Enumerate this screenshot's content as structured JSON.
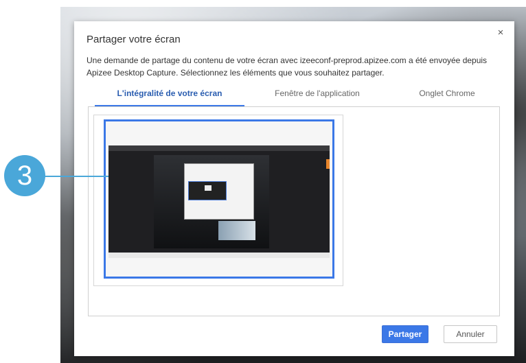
{
  "dialog": {
    "title": "Partager votre écran",
    "close_glyph": "×",
    "description": "Une demande de partage du contenu de votre écran avec izeeconf-preprod.apizee.com a été envoyée depuis Apizee Desktop Capture. Sélectionnez les éléments que vous souhaitez partager.",
    "tabs": [
      {
        "label": "L'intégralité de votre écran",
        "active": true
      },
      {
        "label": "Fenêtre de l'application",
        "active": false
      },
      {
        "label": "Onglet Chrome",
        "active": false
      }
    ],
    "primary_button": "Partager",
    "secondary_button": "Annuler"
  },
  "annotation": {
    "step_number": "3"
  },
  "colors": {
    "accent": "#3b78e7",
    "step_badge": "#4aa7d9"
  },
  "icons": [
    "close-icon"
  ]
}
